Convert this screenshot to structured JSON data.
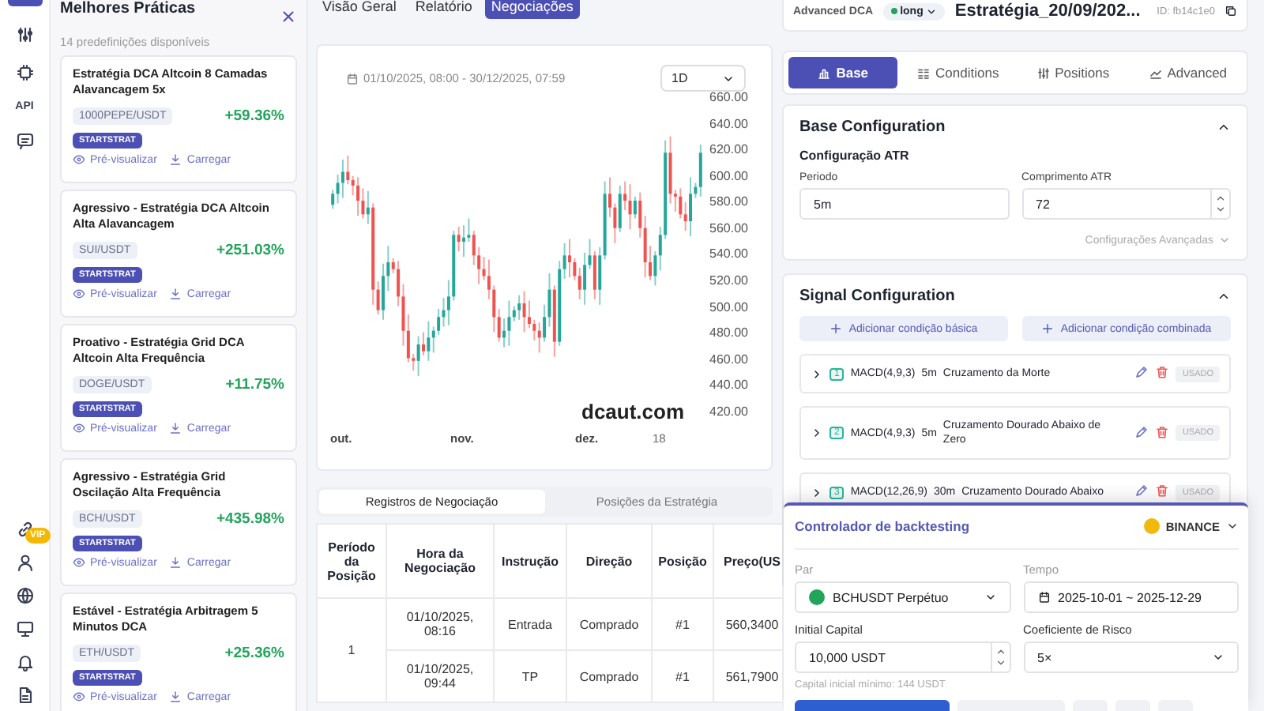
{
  "rail": {
    "api_label": "API",
    "vip_badge": "VIP"
  },
  "presets": {
    "title": "Melhores Práticas",
    "subtitle": "14 predefinições disponíveis",
    "cards": [
      {
        "title": "Estratégia DCA Altcoin 8 Camadas Alavancagem 5x",
        "pair": "1000PEPE/USDT",
        "return": "+59.36%",
        "tag": "STARTSTRAT",
        "preview": "Pré-visualizar",
        "load": "Carregar"
      },
      {
        "title": "Agressivo - Estratégia DCA Altcoin Alta Alavancagem",
        "pair": "SUI/USDT",
        "return": "+251.03%",
        "tag": "STARTSTRAT",
        "preview": "Pré-visualizar",
        "load": "Carregar"
      },
      {
        "title": "Proativo - Estratégia Grid DCA Altcoin Alta Frequência",
        "pair": "DOGE/USDT",
        "return": "+11.75%",
        "tag": "STARTSTRAT",
        "preview": "Pré-visualizar",
        "load": "Carregar"
      },
      {
        "title": "Agressivo - Estratégia Grid Oscilação Alta Frequência",
        "pair": "BCH/USDT",
        "return": "+435.98%",
        "tag": "STARTSTRAT",
        "preview": "Pré-visualizar",
        "load": "Carregar"
      },
      {
        "title": "Estável - Estratégia Arbitragem 5 Minutos DCA",
        "pair": "ETH/USDT",
        "return": "+25.36%",
        "tag": "STARTSTRAT",
        "preview": "Pré-visualizar",
        "load": "Carregar"
      }
    ]
  },
  "main_tabs": [
    {
      "label": "Visão Geral",
      "selected": false
    },
    {
      "label": "Relatório",
      "selected": false
    },
    {
      "label": "Negociações",
      "selected": true
    }
  ],
  "chart": {
    "date_range": "01/10/2025, 08:00 - 30/12/2025, 07:59",
    "interval": "1D",
    "y_labels": [
      "660.00",
      "640.00",
      "620.00",
      "600.00",
      "580.00",
      "560.00",
      "540.00",
      "520.00",
      "500.00",
      "480.00",
      "460.00",
      "440.00",
      "420.00"
    ],
    "x_labels": [
      "out.",
      "nov.",
      "dez.",
      "18"
    ],
    "watermark": "dcaut.com"
  },
  "record_tabs": [
    {
      "label": "Registros de Negociação",
      "selected": true
    },
    {
      "label": "Posições da Estratégia",
      "selected": false
    }
  ],
  "table": {
    "columns": [
      "Período da Posição",
      "Hora da Negociação",
      "Instrução",
      "Direção",
      "Posição",
      "Preço(US"
    ],
    "groups": [
      {
        "period": "1",
        "trades": [
          {
            "time": "01/10/2025, 08:16",
            "instruction": "Entrada",
            "direction": "Comprado",
            "position": "#1",
            "price": "560,3400"
          },
          {
            "time": "01/10/2025, 09:44",
            "instruction": "TP",
            "direction": "Comprado",
            "position": "#1",
            "price": "561,7900"
          }
        ]
      }
    ]
  },
  "strategy": {
    "type": "Advanced DCA",
    "direction": "long",
    "name": "Estratégia_20/09/202...",
    "id": "ID: fb14c1e0"
  },
  "config_tabs": [
    {
      "label": "Base",
      "selected": true
    },
    {
      "label": "Conditions",
      "selected": false
    },
    {
      "label": "Positions",
      "selected": false
    },
    {
      "label": "Advanced",
      "selected": false
    }
  ],
  "base_config": {
    "title": "Base Configuration",
    "subtitle": "Configuração ATR",
    "fields": [
      {
        "label": "Periodo",
        "value": "5m",
        "kind": "text"
      },
      {
        "label": "Comprimento ATR",
        "value": "72",
        "kind": "stepper"
      }
    ],
    "advanced_link": "Configurações Avançadas"
  },
  "signal_config": {
    "title": "Signal Configuration",
    "add_basic": "Adicionar condição básica",
    "add_combined": "Adicionar condição combinada",
    "conditions": [
      {
        "index": "1",
        "indicator": "MACD(4,9,3)",
        "timeframe": "5m",
        "event": "Cruzamento da Morte",
        "status": "USADO"
      },
      {
        "index": "2",
        "indicator": "MACD(4,9,3)",
        "timeframe": "5m",
        "event": "Cruzamento Dourado Abaixo de Zero",
        "status": "USADO"
      },
      {
        "index": "3",
        "indicator": "MACD(12,26,9)",
        "timeframe": "30m",
        "event": "Cruzamento Dourado Abaixo",
        "status": "USADO"
      }
    ]
  },
  "backtest": {
    "title": "Controlador de backtesting",
    "exchange": "BINANCE",
    "pair_label": "Par",
    "pair": "BCHUSDT Perpétuo",
    "time_label": "Tempo",
    "time": "2025-10-01 ~ 2025-12-29",
    "capital_label": "Initial Capital",
    "capital": "10,000 USDT",
    "risk_label": "Coeficiente de Risco",
    "risk": "5×",
    "hint": "Capital inicial mínimo: 144 USDT"
  }
}
